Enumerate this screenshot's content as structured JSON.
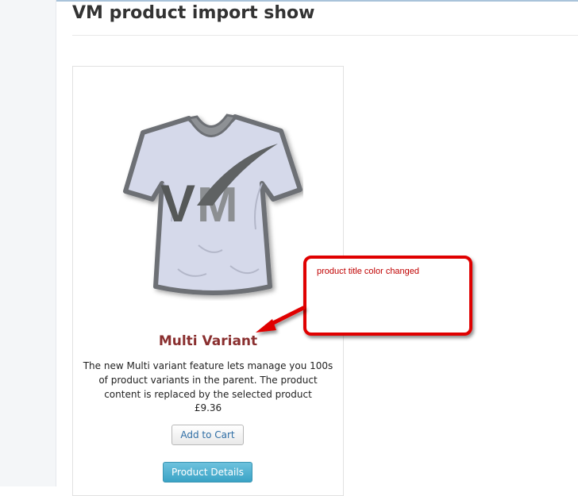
{
  "page": {
    "title": "VM product import show"
  },
  "product": {
    "image_logo": "VM",
    "title": "Multi Variant",
    "description": "The new Multi variant feature lets manage you 100s of product variants in the parent. The product content is replaced by the selected product",
    "price": "£9.36",
    "add_to_cart_label": "Add to Cart",
    "details_label": "Product Details"
  },
  "annotation": {
    "text": "product title color changed"
  },
  "colors": {
    "title_color": "#8a2f2f",
    "annotation_red": "#e00000",
    "details_button": "#3aa3c6"
  },
  "icons": {
    "product_image": "vm-tshirt-image",
    "annotation_arrow": "arrow-icon"
  }
}
